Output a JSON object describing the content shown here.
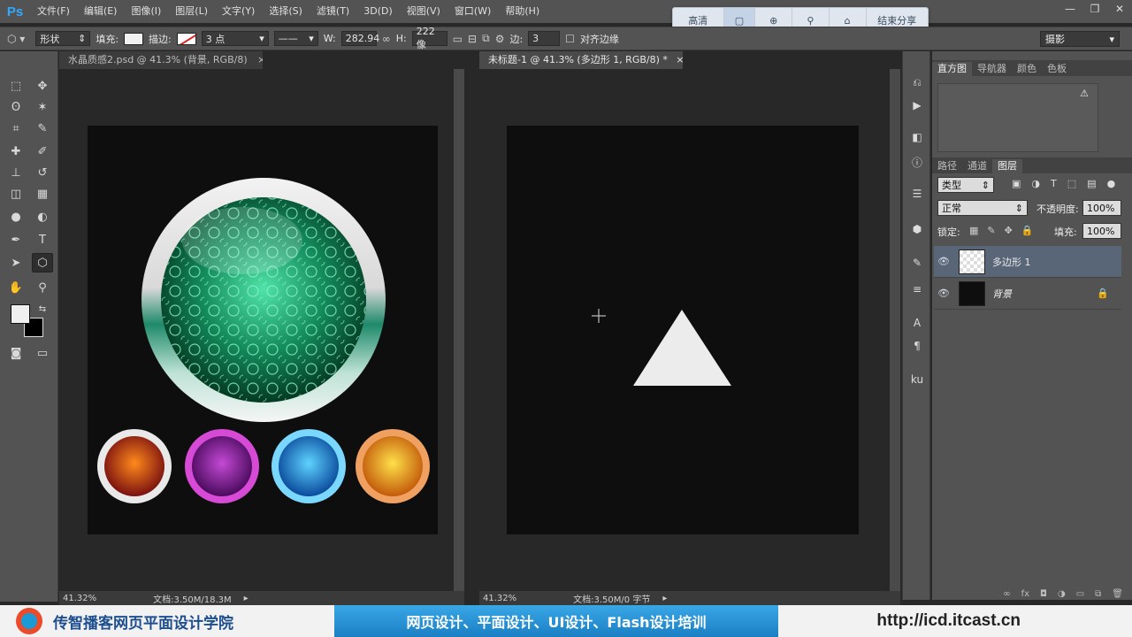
{
  "app": {
    "logo": "Ps"
  },
  "menu": [
    "文件(F)",
    "编辑(E)",
    "图像(I)",
    "图层(L)",
    "文字(Y)",
    "选择(S)",
    "滤镜(T)",
    "3D(D)",
    "视图(V)",
    "窗口(W)",
    "帮助(H)"
  ],
  "share_toolbar": {
    "hd": "高清",
    "end_share": "结束分享"
  },
  "options": {
    "mode": "形状",
    "fill_label": "填充:",
    "stroke_label": "描边:",
    "stroke_size": "3 点",
    "w_label": "W:",
    "w_value": "282.94",
    "h_label": "H:",
    "h_value": "222 像",
    "sides_label": "边:",
    "sides_value": "3",
    "align_edges": "对齐边缘",
    "workspace": "摄影"
  },
  "doc1": {
    "tab": "水晶质感2.psd @ 41.3% (背景, RGB/8)",
    "zoom": "41.32%",
    "status": "文档:3.50M/18.3M"
  },
  "doc2": {
    "tab": "未标题-1 @ 41.3% (多边形 1, RGB/8) *",
    "zoom": "41.32%",
    "status": "文档:3.50M/0 字节"
  },
  "panel_top": {
    "tabs": [
      "直方图",
      "导航器",
      "颜色",
      "色板"
    ]
  },
  "layers_panel": {
    "tabs": [
      "路径",
      "通道",
      "图层"
    ],
    "filter_kind": "类型",
    "blend_mode": "正常",
    "opacity_label": "不透明度:",
    "opacity": "100%",
    "lock_label": "锁定:",
    "fill_label": "填充:",
    "fill": "100%",
    "layers": [
      {
        "name": "多边形 1",
        "selected": true
      },
      {
        "name": "背景",
        "selected": false
      }
    ]
  },
  "banner": {
    "school": "传智播客网页平面设计学院",
    "slogan": "网页设计、平面设计、UI设计、Flash设计培训",
    "url": "http://icd.itcast.cn"
  },
  "colors": {
    "accent": "#31a8ff",
    "selected_layer": "#596678",
    "canvas": "#0e0e0e"
  }
}
